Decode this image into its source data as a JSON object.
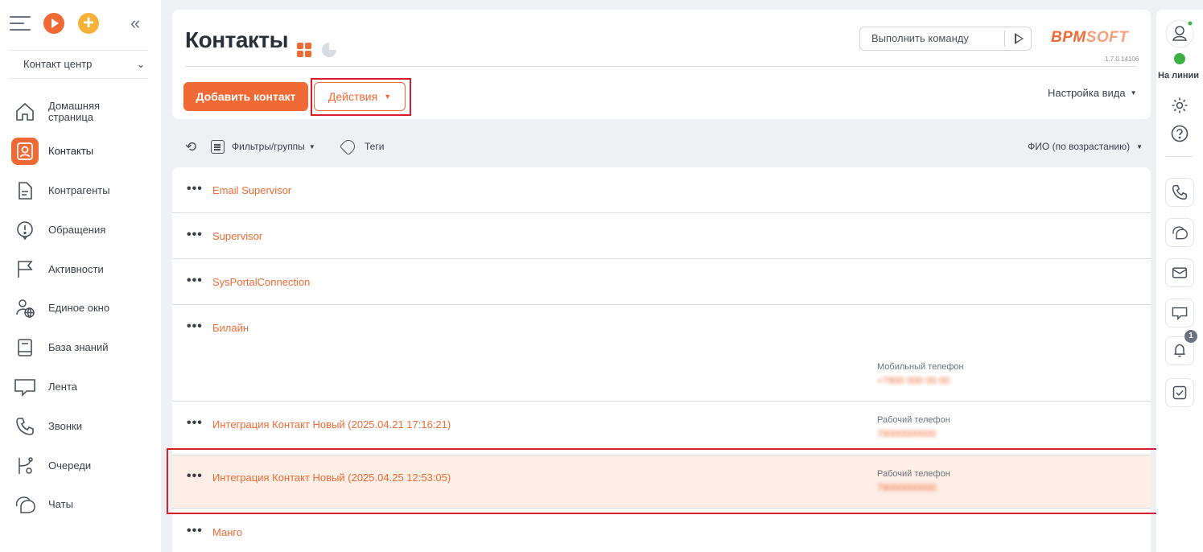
{
  "sidebar": {
    "workspace": "Контакт центр",
    "items": [
      {
        "label": "Домашняя страница",
        "icon": "home-icon"
      },
      {
        "label": "Контакты",
        "icon": "contact-icon",
        "active": true
      },
      {
        "label": "Контрагенты",
        "icon": "document-icon"
      },
      {
        "label": "Обращения",
        "icon": "alert-icon"
      },
      {
        "label": "Активности",
        "icon": "flag-icon"
      },
      {
        "label": "Единое окно",
        "icon": "user-globe-icon"
      },
      {
        "label": "База знаний",
        "icon": "book-icon"
      },
      {
        "label": "Лента",
        "icon": "chat-bubble-icon"
      },
      {
        "label": "Звонки",
        "icon": "phone-icon"
      },
      {
        "label": "Очереди",
        "icon": "queue-icon"
      },
      {
        "label": "Чаты",
        "icon": "chats-icon"
      }
    ]
  },
  "header": {
    "title": "Контакты",
    "command_placeholder": "Выполнить команду",
    "logo_main": "BPM",
    "logo_soft": "SOFT",
    "version": "1.7.0.14106",
    "add_button": "Добавить контакт",
    "actions_button": "Действия",
    "view_settings": "Настройка вида"
  },
  "toolbar": {
    "filters": "Фильтры/группы",
    "tags": "Теги",
    "sort": "ФИО (по возрастанию)"
  },
  "contacts": [
    {
      "name": "Email Supervisor",
      "field_label": "",
      "field_value": ""
    },
    {
      "name": "Supervisor",
      "field_label": "",
      "field_value": ""
    },
    {
      "name": "SysPortalConnection",
      "field_label": "",
      "field_value": ""
    },
    {
      "name": "Билайн",
      "field_label": "Мобильный телефон",
      "field_value": "+7900 000 00 00"
    },
    {
      "name": "Интеграция Контакт Новый (2025.04.21 17:16:21)",
      "field_label": "Рабочий телефон",
      "field_value": "79000000000"
    },
    {
      "name": "Интеграция Контакт Новый (2025.04.25 12:53:05)",
      "field_label": "Рабочий телефон",
      "field_value": "79000000000"
    },
    {
      "name": "Манго",
      "field_label": "",
      "field_value": ""
    }
  ],
  "right_panel": {
    "status_text": "На линии",
    "notification_count": "1"
  },
  "colors": {
    "accent": "#f06a35",
    "highlight_row": "#fdeee6",
    "annotation_red": "#d81e2c",
    "online_green": "#3cb043"
  }
}
